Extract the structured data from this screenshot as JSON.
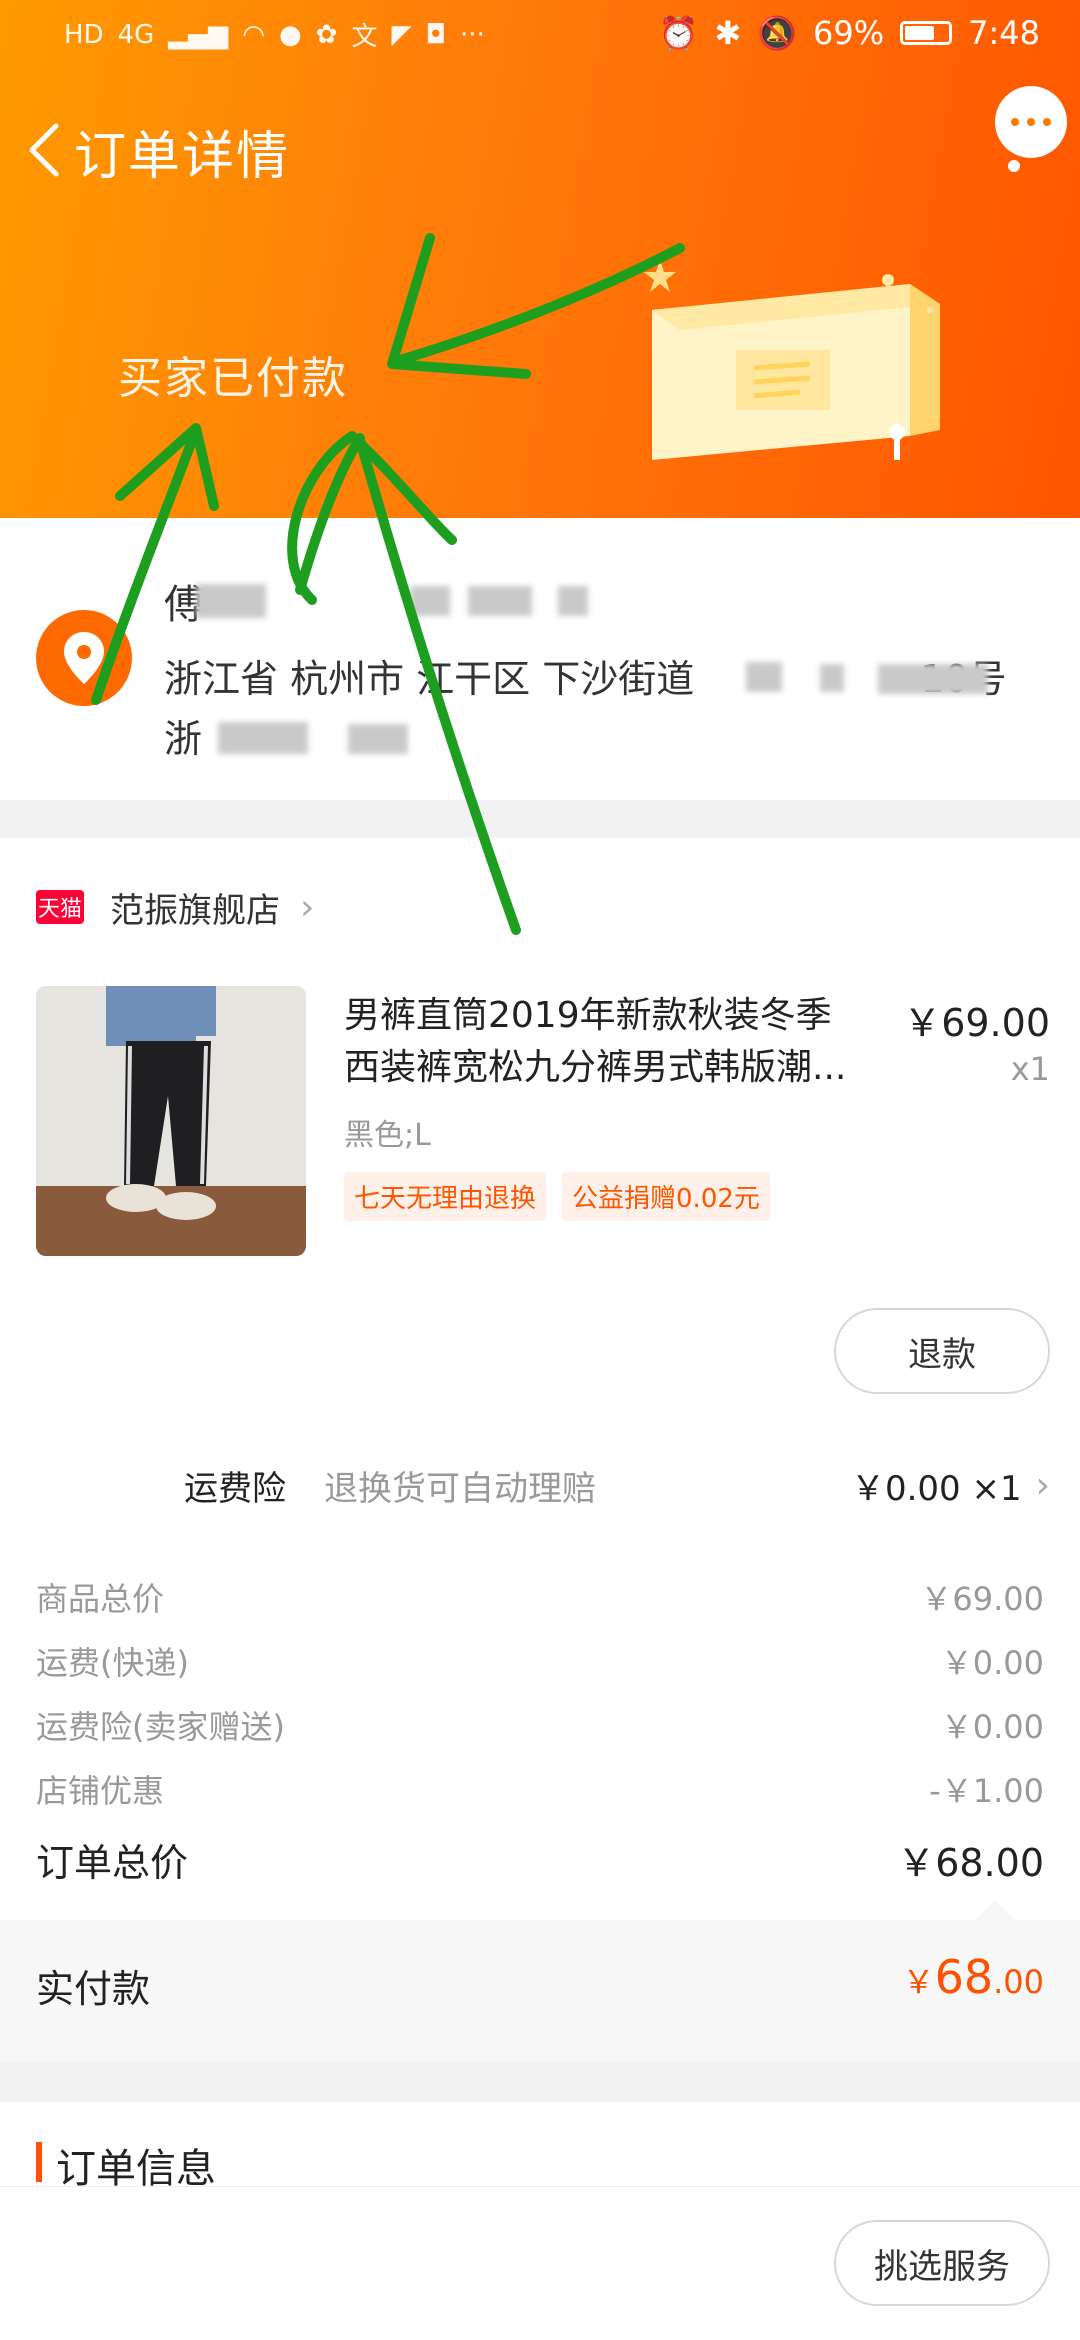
{
  "status_bar": {
    "left_icons": [
      "HD",
      "4G",
      "signal-icon",
      "wifi-icon",
      "chat-icon",
      "huawei-icon",
      "translate-icon",
      "navigation-icon",
      "shield-icon",
      "···"
    ],
    "battery": "69%",
    "time": "7:48"
  },
  "header": {
    "title": "订单详情",
    "order_status": "买家已付款"
  },
  "address": {
    "name": "傅",
    "line1": "浙江省 杭州市 江干区 下沙街道",
    "line1_suffix": "10号",
    "line2": "浙"
  },
  "shop": {
    "badge": "天猫",
    "name": "范振旗舰店"
  },
  "product": {
    "title_line1": "男裤直筒2019年新款秋装冬季",
    "title_line2": "西装裤宽松九分裤男式韩版潮...",
    "price": "￥69.00",
    "qty": "x1",
    "sku": "黑色;L",
    "tags": [
      "七天无理由退换",
      "公益捐赠0.02元"
    ]
  },
  "actions": {
    "refund": "退款",
    "pick_service": "挑选服务"
  },
  "insurance": {
    "label": "运费险",
    "desc": "退换货可自动理赔",
    "value": "￥0.00 ×1"
  },
  "summary": [
    {
      "label": "商品总价",
      "value": "￥69.00"
    },
    {
      "label": "运费(快递)",
      "value": "￥0.00"
    },
    {
      "label": "运费险(卖家赠送)",
      "value": "￥0.00"
    },
    {
      "label": "店铺优惠",
      "value": "-￥1.00"
    }
  ],
  "total": {
    "label": "订单总价",
    "value": "￥68.00"
  },
  "paid": {
    "label": "实付款",
    "currency": "￥",
    "integer": "68",
    "decimal": ".00"
  },
  "order_info": {
    "title": "订单信息"
  },
  "colors": {
    "header_start": "#ff9a00",
    "header_end": "#ff5500",
    "accent": "#ff5000",
    "annotation_green": "#1e9e1e"
  }
}
